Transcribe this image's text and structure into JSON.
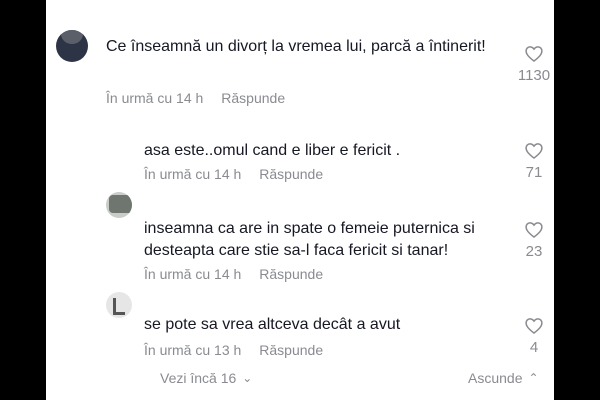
{
  "comments": [
    {
      "text": "Ce înseamnă un divorț la vremea lui, parcă a întinerit!",
      "time": "În urmă cu 14 h",
      "reply": "Răspunde",
      "likes": "1130"
    },
    {
      "text": "asa este..omul cand e liber e fericit .",
      "time": "În urmă cu 14 h",
      "reply": "Răspunde",
      "likes": "71"
    },
    {
      "text": "inseamna ca are in spate o femeie puternica si desteapta care stie sa-l faca fericit si tanar!",
      "time": "În urmă cu 14 h",
      "reply": "Răspunde",
      "likes": "23"
    },
    {
      "text": "se pote sa vrea altceva decât a avut",
      "time": "În urmă cu 13 h",
      "reply": "Răspunde",
      "likes": "4"
    }
  ],
  "footer": {
    "view_more": "Vezi încă 16",
    "hide": "Ascunde"
  },
  "icons": {
    "like": "heart-outline-icon",
    "expand": "chevron-down-icon",
    "collapse": "chevron-up-icon"
  }
}
